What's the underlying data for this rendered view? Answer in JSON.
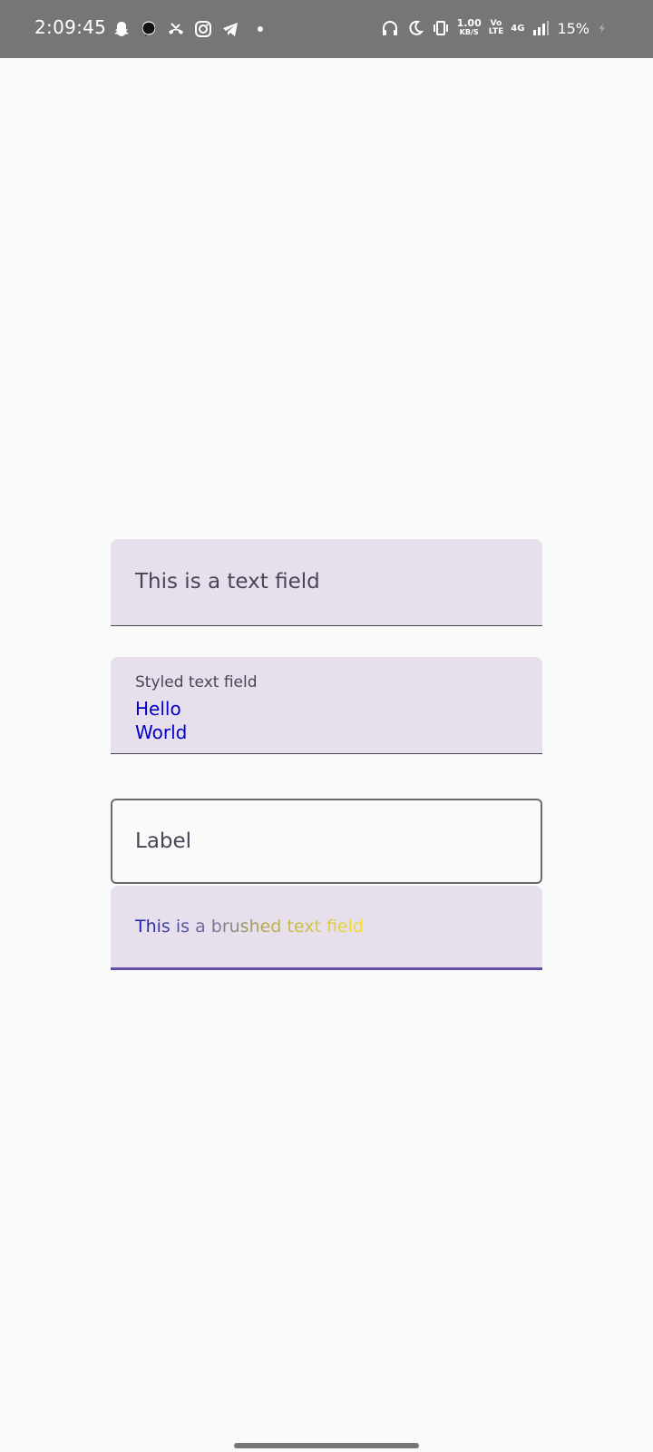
{
  "status_bar": {
    "time": "2:09:45",
    "net_speed_value": "1.00",
    "net_speed_unit": "KB/S",
    "volte_top": "Vo",
    "volte_bottom": "LTE",
    "network": "4G",
    "battery": "15%",
    "left_icons": [
      "snapchat-icon",
      "message-bubble-icon",
      "missed-call-icon",
      "instagram-icon",
      "telegram-icon",
      "more-dot"
    ],
    "right_icons": [
      "headphones-icon",
      "moon-icon",
      "vibrate-icon",
      "signal-icon",
      "charging-icon"
    ]
  },
  "fields": {
    "basic": {
      "text": "This is a text field"
    },
    "styled": {
      "label": "Styled text field",
      "line1": "Hello",
      "line2": "World",
      "text_color": "#0000c8"
    },
    "outlined": {
      "text": "Label"
    },
    "brushed": {
      "text": "This is a brushed text field",
      "gradient": [
        "#1a1ab0",
        "#6c6c9c",
        "#b8b04a",
        "#f5e12a"
      ],
      "indicator_color": "#6750a4"
    }
  },
  "colors": {
    "background": "#fafafa",
    "status_bar": "#767676",
    "filled_container": "#e7dfec"
  }
}
